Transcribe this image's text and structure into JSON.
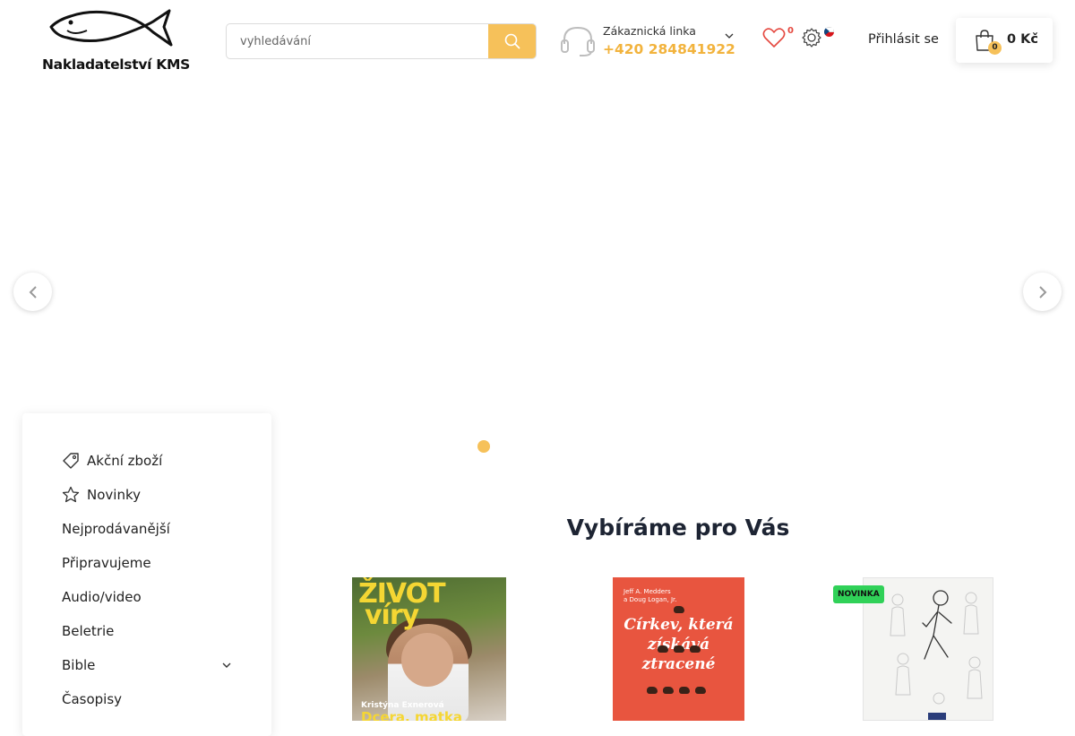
{
  "header": {
    "logo_text": "Nakladatelství KMS",
    "search_placeholder": "vyhledávání",
    "hotline_title": "Zákaznická linka",
    "hotline_phone": "+420 284841922",
    "wishlist_count": "0",
    "login_label": "Přihlásit se",
    "cart_count": "0",
    "cart_total": "0 Kč"
  },
  "colors": {
    "accent": "#f6c15a",
    "phone": "#f2b33d",
    "wishlist_count": "#e5483f",
    "badge_new": "#30d158"
  },
  "slider": {
    "active_slide": 1
  },
  "categories": [
    {
      "label": "Akční zboží",
      "icon": "tag-icon"
    },
    {
      "label": "Novinky",
      "icon": "star-icon"
    },
    {
      "label": "Nejprodávanější"
    },
    {
      "label": "Připravujeme"
    },
    {
      "label": "Audio/video"
    },
    {
      "label": "Beletrie"
    },
    {
      "label": "Bible",
      "has_submenu": true
    },
    {
      "label": "Časopisy"
    }
  ],
  "recommend": {
    "title": "Vybíráme pro Vás",
    "products": [
      {
        "cover_title_1": "ŽIVOT",
        "cover_title_2": "víry",
        "cover_author": "Kristýna Exnerová",
        "cover_subtitle": "Dcera, matka"
      },
      {
        "cover_author_1": "Jeff A. Medders",
        "cover_author_2": "a Doug Logan, Jr.",
        "cover_title": "Církev, která získává ztracené"
      },
      {
        "badge": "NOVINKA"
      }
    ]
  }
}
